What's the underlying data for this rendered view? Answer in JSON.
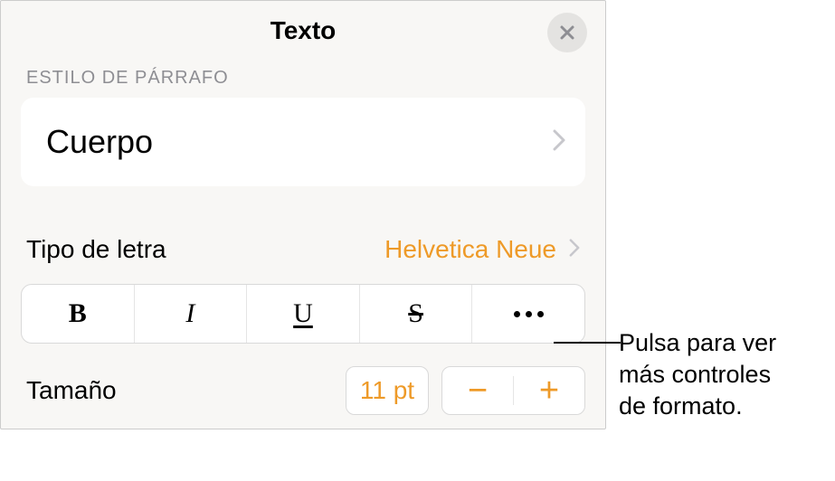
{
  "panel": {
    "title": "Texto",
    "section_label": "ESTILO DE PÁRRAFO",
    "paragraph_style": "Cuerpo",
    "font_label": "Tipo de letra",
    "font_value": "Helvetica Neue",
    "size_label": "Tamaño",
    "size_value": "11 pt"
  },
  "callout": {
    "text": "Pulsa para ver\nmás controles\nde formato."
  },
  "icons": {
    "bold": "B",
    "italic": "I",
    "underline": "U",
    "strike": "S"
  },
  "colors": {
    "accent": "#ee9a28"
  }
}
